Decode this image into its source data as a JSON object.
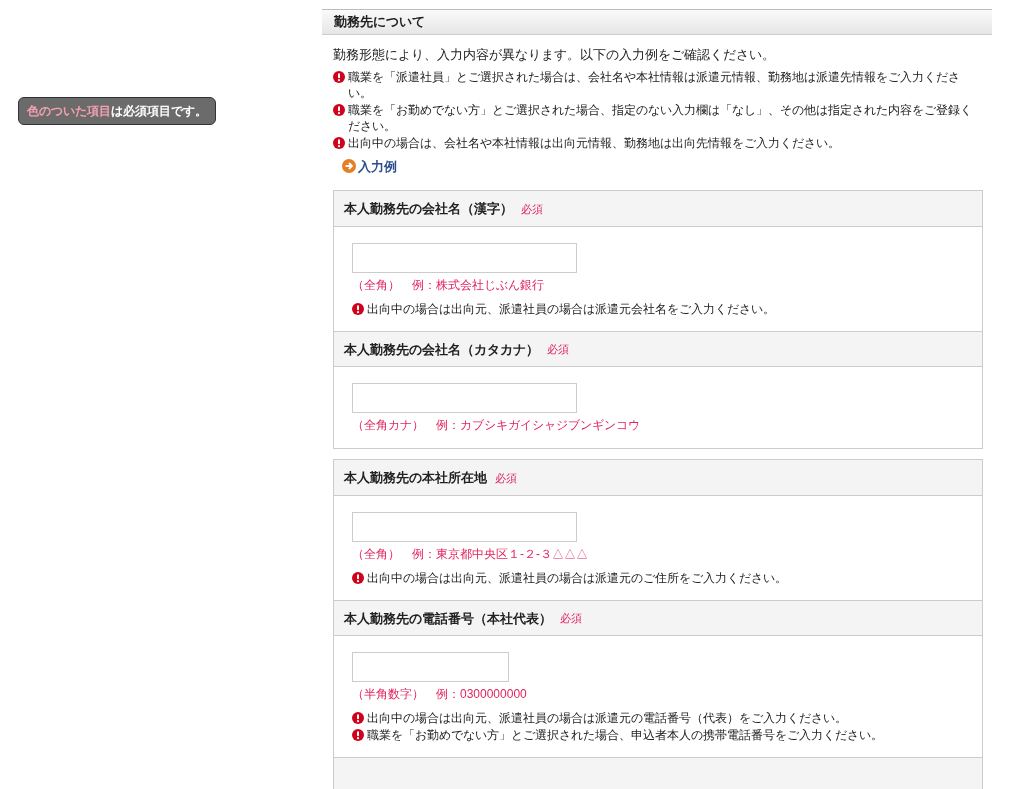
{
  "badge": {
    "highlight": "色のついた項目",
    "text": "は必須項目です。"
  },
  "section": {
    "title": "勤務先について",
    "intro": "勤務形態により、入力内容が異なります。以下の入力例をご確認ください。",
    "notes": [
      "職業を「派遣社員」とご選択された場合は、会社名や本社情報は派遣元情報、勤務地は派遣先情報をご入力ください。",
      "職業を「お勤めでない方」とご選択された場合、指定のない入力欄は「なし」、その他は指定された内容をご登録ください。",
      "出向中の場合は、会社名や本社情報は出向元情報、勤務地は出向先情報をご入力ください。"
    ],
    "example_link": "入力例"
  },
  "groups": [
    {
      "fields": [
        {
          "label": "本人勤務先の会社名（漢字）",
          "required": "必須",
          "kind": "text",
          "hint": "（全角）　例：株式会社じぶん銀行",
          "notes": [
            "出向中の場合は出向元、派遣社員の場合は派遣元会社名をご入力ください。"
          ]
        },
        {
          "label": "本人勤務先の会社名（カタカナ）",
          "required": "必須",
          "kind": "text",
          "hint": "（全角カナ）　例：カブシキガイシャジブンギンコウ"
        }
      ]
    },
    {
      "fields": [
        {
          "label": "本人勤務先の本社所在地",
          "required": "必須",
          "kind": "text",
          "hint": "（全角）　例：東京都中央区１-２-３△△△",
          "notes": [
            "出向中の場合は出向元、派遣社員の場合は派遣元のご住所をご入力ください。"
          ]
        },
        {
          "label": "本人勤務先の電話番号（本社代表）",
          "required": "必須",
          "kind": "phone",
          "hint": "（半角数字）　例：0300000000",
          "notes": [
            "出向中の場合は出向元、派遣社員の場合は派遣元の電話番号（代表）をご入力ください。",
            "職業を「お勤めでない方」とご選択された場合、申込者本人の携帯電話番号をご入力ください。"
          ]
        }
      ]
    }
  ]
}
